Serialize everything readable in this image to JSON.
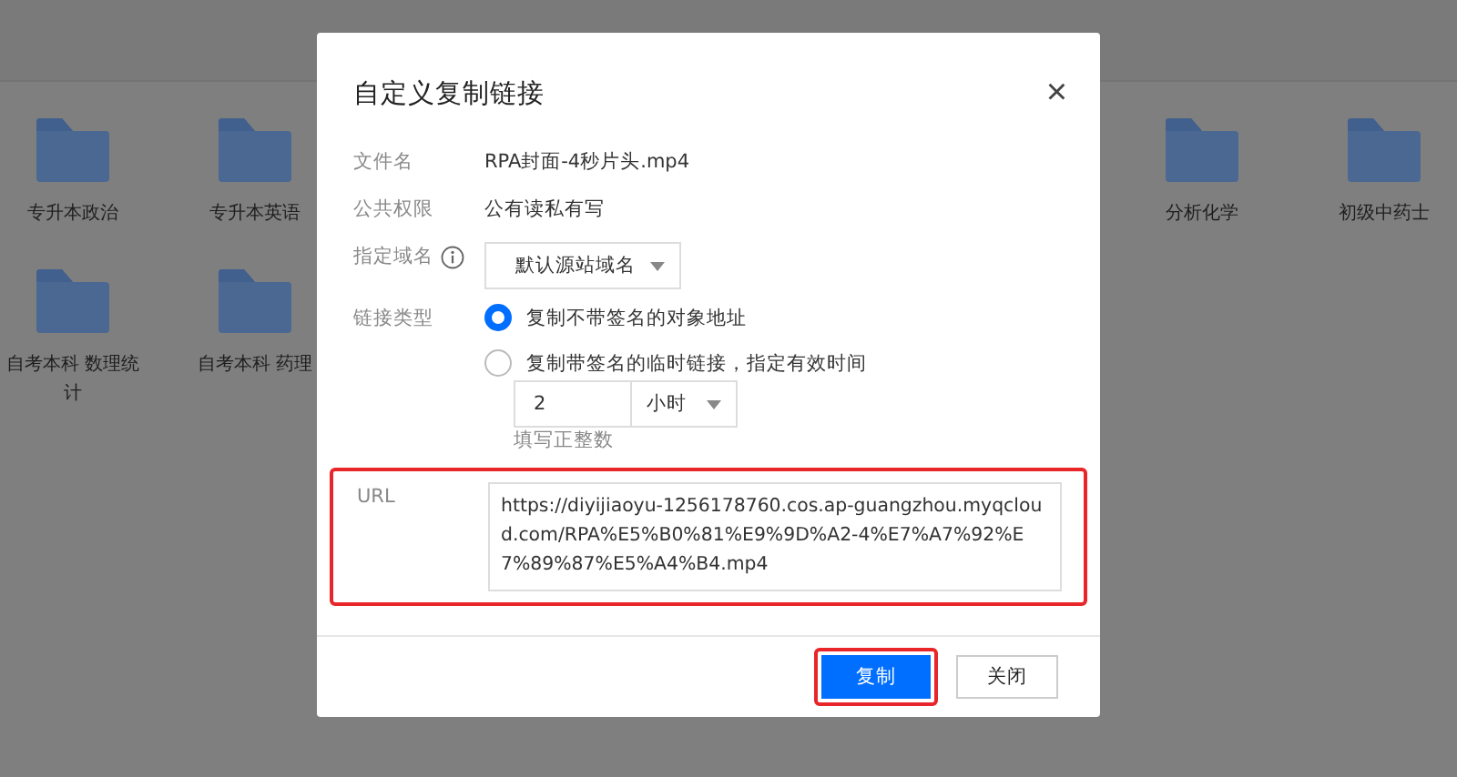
{
  "folders_left": [
    {
      "name": "专升本政治"
    },
    {
      "name": "专升本英语"
    },
    {
      "name": "自考本科 数理统计"
    },
    {
      "name": "自考本科 药理"
    }
  ],
  "folders_right": [
    {
      "name": "分析化学"
    },
    {
      "name": "初级中药士"
    }
  ],
  "dialog": {
    "title": "自定义复制链接",
    "close": "×",
    "file_label": "文件名",
    "file_value": "RPA封面-4秒片头.mp4",
    "perm_label": "公共权限",
    "perm_value": "公有读私有写",
    "domain_label": "指定域名",
    "domain_value": "默认源站域名",
    "link_label": "链接类型",
    "link_options": [
      {
        "label": "复制不带签名的对象地址",
        "selected": true
      },
      {
        "label": "复制带签名的临时链接，指定有效时间",
        "selected": false
      }
    ],
    "duration_value": "2",
    "unit_value": "小时",
    "hint": "填写正整数",
    "url_label": "URL",
    "url_value": "https://diyijiaoyu-1256178760.cos.ap-guangzhou.myqcloud.com/RPA%E5%B0%81%E9%9D%A2-4%E7%A7%92%E7%89%87%E5%A4%B4.mp4",
    "url_highlighted": true,
    "buttons": [
      {
        "label": "复制",
        "kind": "primary",
        "highlighted": true
      },
      {
        "label": "关闭",
        "kind": "default",
        "highlighted": false
      }
    ]
  }
}
